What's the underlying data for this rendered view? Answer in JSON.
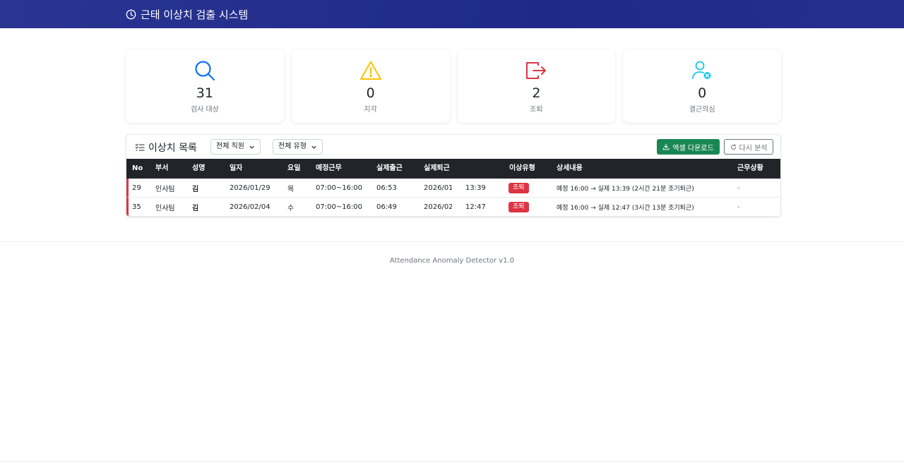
{
  "header": {
    "title": "근태 이상치 검출 시스템",
    "icon": "clock-icon"
  },
  "stats": [
    {
      "icon": "search-icon",
      "value": "31",
      "label": "검사 대상",
      "color": "#0d6efd"
    },
    {
      "icon": "warning-icon",
      "value": "0",
      "label": "지각",
      "color": "#ffc107"
    },
    {
      "icon": "exit-icon",
      "value": "2",
      "label": "조퇴",
      "color": "#dc3545"
    },
    {
      "icon": "user-x-icon",
      "value": "0",
      "label": "결근의심",
      "color": "#0dcaf0"
    }
  ],
  "list": {
    "title": "이상치 목록",
    "filter_employee": "전체 직원",
    "filter_type": "전체 유형",
    "excel_button": "엑셀 다운로드",
    "reanalyze_button": "다시 분석",
    "columns": [
      "No",
      "부서",
      "성명",
      "일자",
      "요일",
      "예정근무",
      "실제출근",
      "실제퇴근",
      "이상유형",
      "상세내용",
      "근무상황"
    ],
    "rows": [
      {
        "no": "29",
        "dept": "인사팀",
        "name": "김",
        "date": "2026/01/29",
        "day": "목",
        "scheduled": "07:00~16:00",
        "in": "06:53",
        "out_date": "2026/01/",
        "out_time": "13:39",
        "type": "조퇴",
        "detail": "예정 16:00 → 실제 13:39 (2시간 21분 조기퇴근)",
        "status": "-"
      },
      {
        "no": "35",
        "dept": "인사팀",
        "name": "김",
        "date": "2026/02/04",
        "day": "수",
        "scheduled": "07:00~16:00",
        "in": "06:49",
        "out_date": "2026/02/",
        "out_time": "12:47",
        "type": "조퇴",
        "detail": "예정 16:00 → 실제 12:47 (3시간 13분 조기퇴근)",
        "status": "-"
      }
    ]
  },
  "footer": {
    "text": "Attendance Anomaly Detector v1.0"
  },
  "colors": {
    "navbar": "#252f8d",
    "success": "#198754",
    "danger": "#dc3545",
    "dark": "#212529"
  }
}
